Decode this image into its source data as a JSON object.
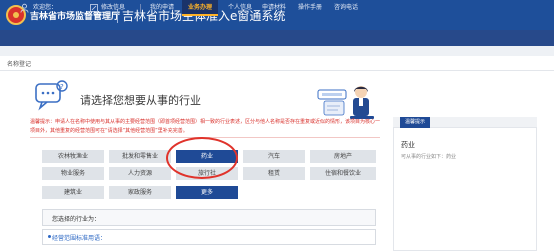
{
  "header": {
    "org_name": "吉林省市场监督管理厅",
    "system_title": "吉林省市场主体准入e窗通系统"
  },
  "navbar": {
    "welcome": "欢迎您：",
    "edit_info": "修改信息",
    "items": [
      "我的申请",
      "业务办理",
      "个人信息",
      "申请材料",
      "操作手册",
      "咨询电话"
    ],
    "active": "业务办理",
    "active_color": "#ffb327"
  },
  "breadcrumb": "名称登记",
  "main": {
    "title": "请选择您想要从事的行业",
    "warning": "温馨提示：申请人在名称中使用与其从事的主要经营范围（即首项经营范围）相一致的行业表述，区分与他人名称是否存在重复或近似的情形，该项目为核心一项目外，其他重复的经营范围可在“请选择”其他经营范围”里补充完善。",
    "industries": [
      [
        "农林牧渔业",
        "批发和零售业",
        "药业",
        "汽车",
        "房地产"
      ],
      [
        "物业服务",
        "人力资源",
        "旅行社",
        "租赁",
        "住宿和餐饮业"
      ],
      [
        "建筑业",
        "家政服务",
        "更多"
      ]
    ],
    "selected": "药业",
    "more": "更多",
    "chosen_label": "您选择的行业为：",
    "std_label": "经营范围标准用语："
  },
  "side": {
    "tab": "温馨提示",
    "title": "药业",
    "subtitle": "可从事的行业如下：药业"
  },
  "colors": {
    "brand": "#1e4f9a",
    "warning": "#d9302b",
    "selected": "#1f4a96"
  }
}
